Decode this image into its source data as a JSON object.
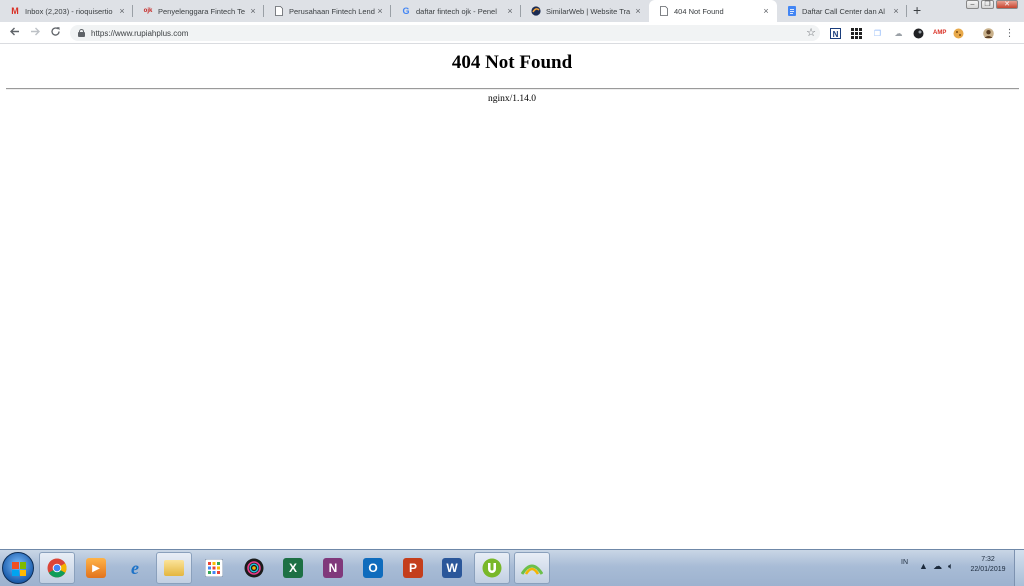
{
  "browser": {
    "tabs": [
      {
        "title": "Inbox (2,203) - rioquisertio",
        "favicon": "gmail-icon",
        "active": false
      },
      {
        "title": "Penyelenggara Fintech Te",
        "favicon": "ojk-icon",
        "active": false
      },
      {
        "title": "Perusahaan Fintech Lendi",
        "favicon": "page-icon",
        "active": false
      },
      {
        "title": "daftar fintech ojk - Penel",
        "favicon": "google-icon",
        "active": false
      },
      {
        "title": "SimilarWeb | Website Tra",
        "favicon": "similarweb-icon",
        "active": false
      },
      {
        "title": "404 Not Found",
        "favicon": "page-icon",
        "active": true
      },
      {
        "title": "Daftar Call Center dan Al",
        "favicon": "docs-icon",
        "active": false
      }
    ],
    "new_tab_label": "+",
    "close_glyph": "×",
    "url": "https://www.rupiahplus.com",
    "accent_color": "#1a73e8"
  },
  "page": {
    "title": "404 Not Found",
    "server": "nginx/1.14.0"
  },
  "taskbar": {
    "language": "IN",
    "time": "7:32",
    "date": "22/01/2019",
    "apps": [
      "chrome-icon",
      "media-player-icon",
      "internet-explorer-icon",
      "file-explorer-icon",
      "app-grid-icon",
      "camera-app-icon",
      "excel-icon",
      "onenote-icon",
      "outlook-icon",
      "powerpoint-icon",
      "word-icon",
      "utorrent-icon",
      "network-app-icon"
    ],
    "app_letters": {
      "excel": "X",
      "onenote": "N",
      "outlook": "O",
      "powerpoint": "P",
      "word": "W"
    }
  }
}
